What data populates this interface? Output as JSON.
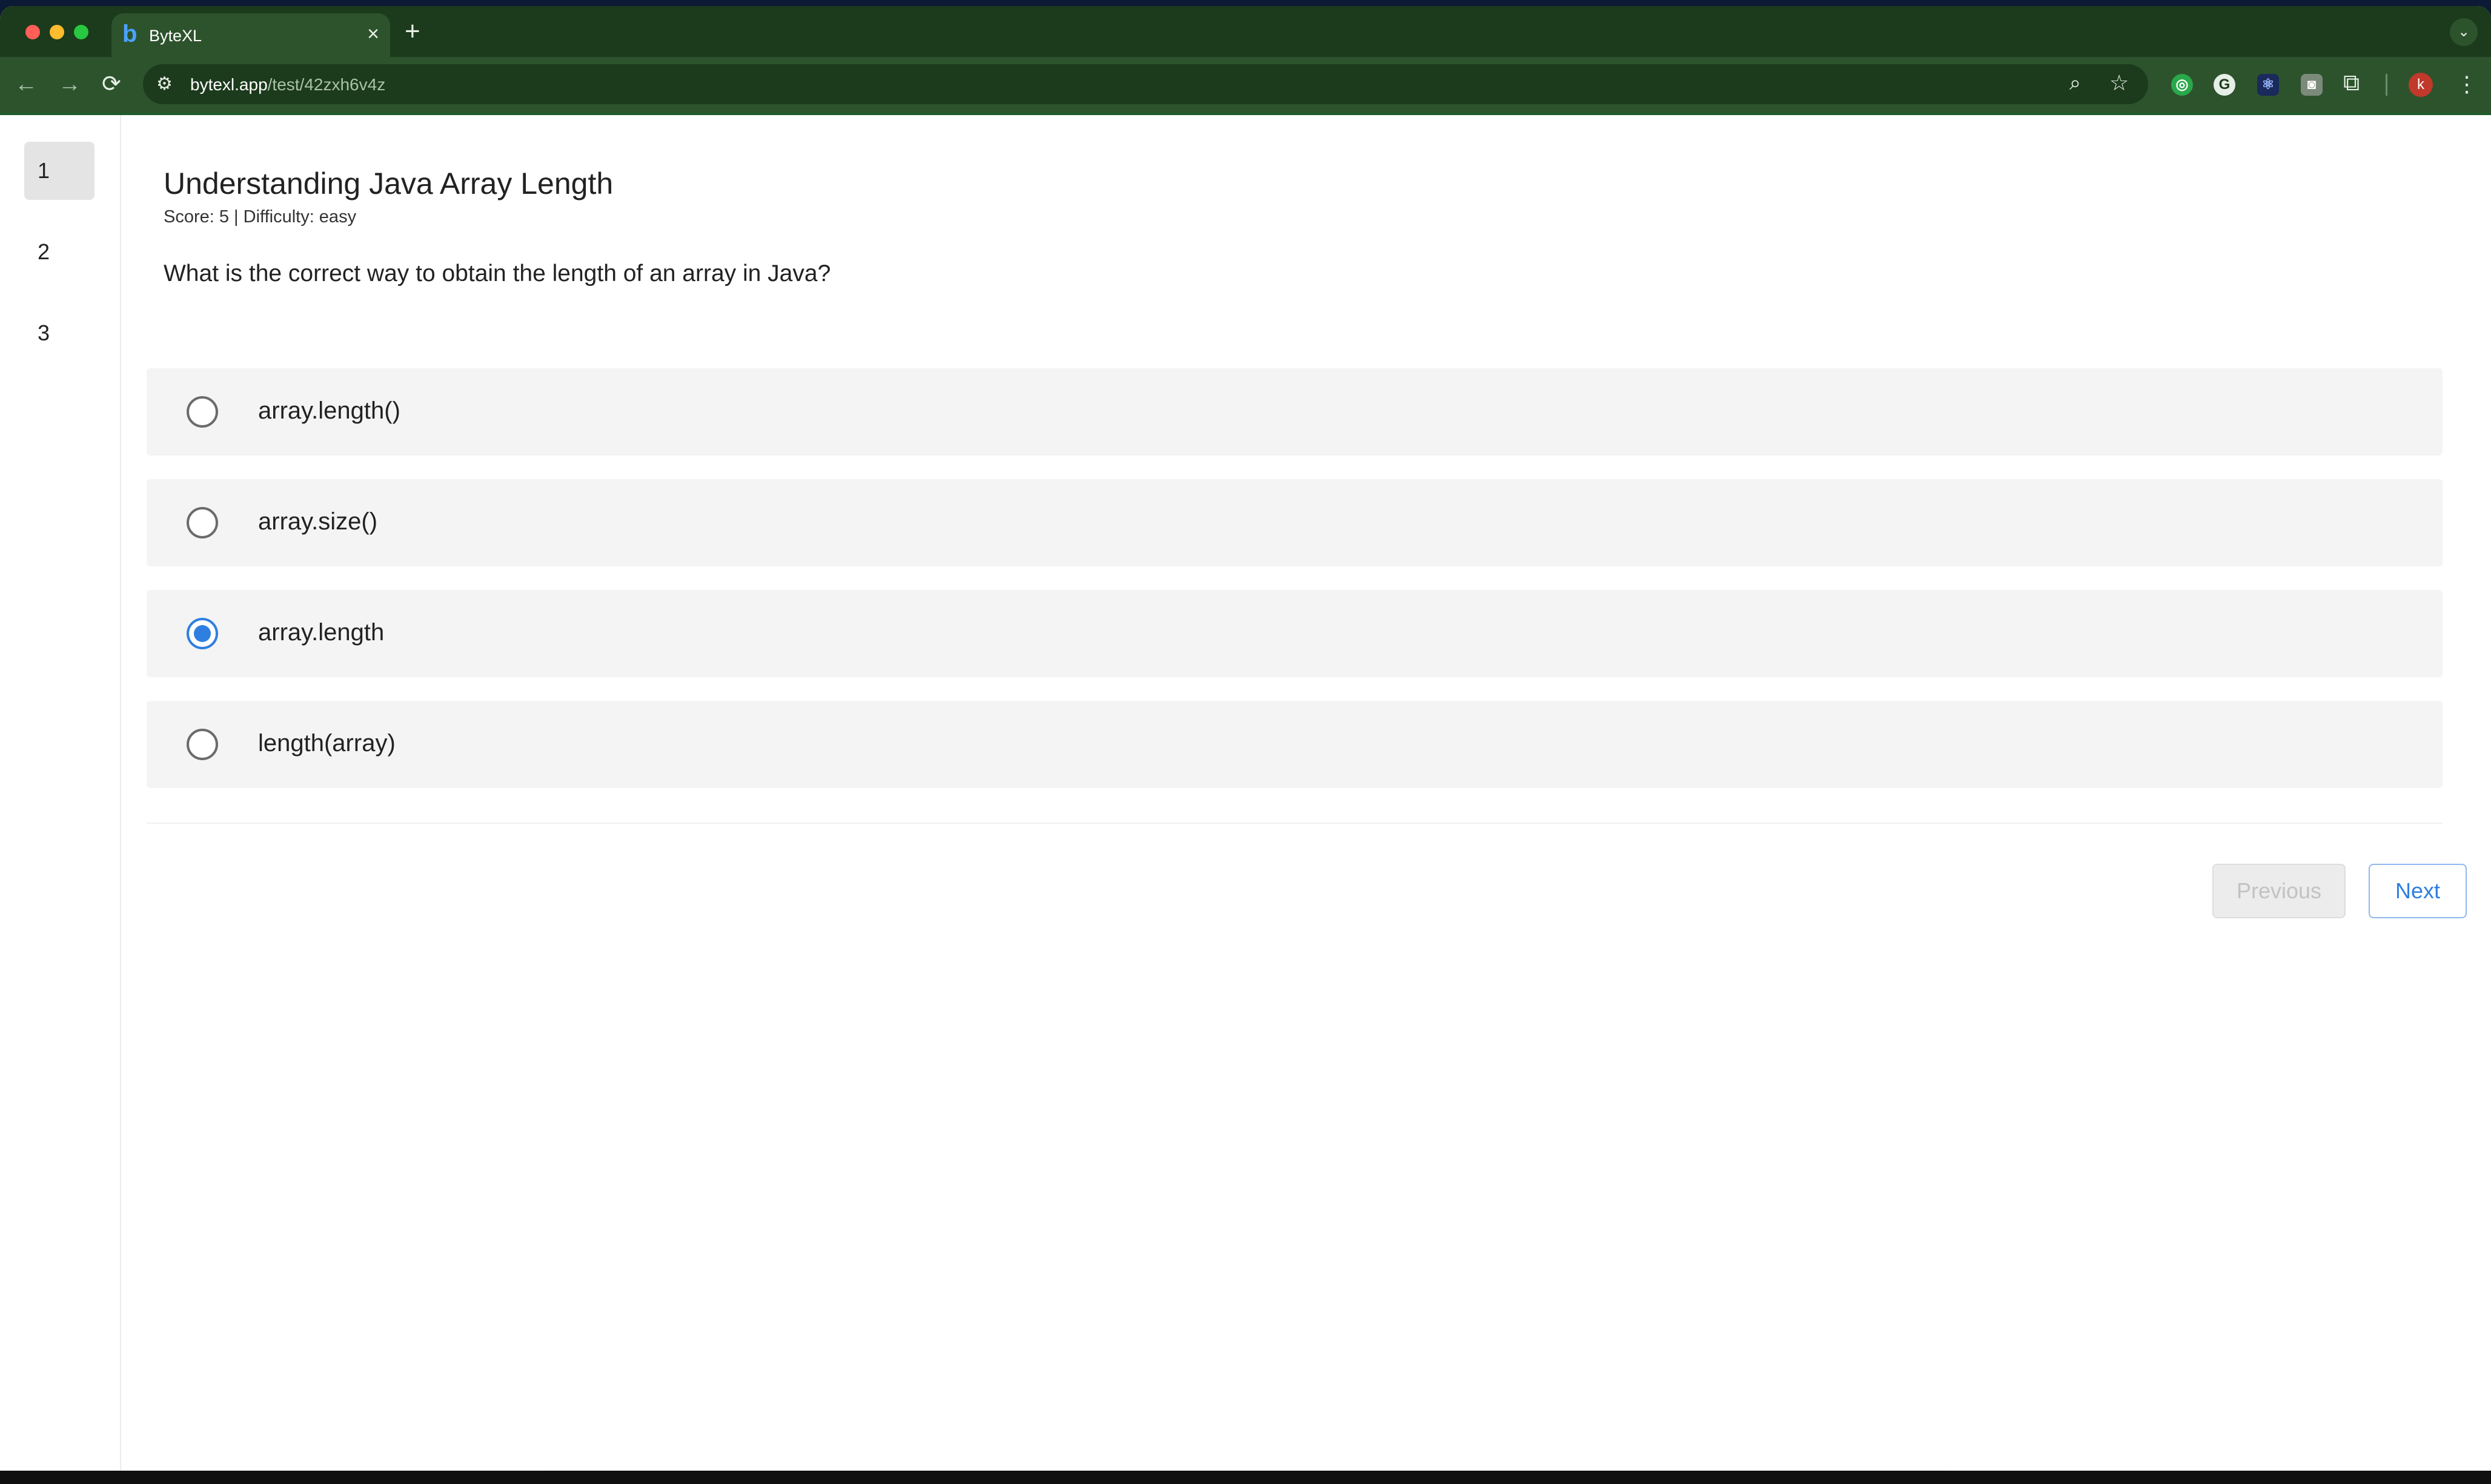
{
  "browser": {
    "tab": {
      "favicon": "b",
      "title": "ByteXL",
      "close_glyph": "×"
    },
    "new_tab_glyph": "+",
    "tab_menu_glyph": "⌄",
    "nav": {
      "back_glyph": "←",
      "forward_glyph": "→",
      "reload_glyph": "⟳"
    },
    "site_info_glyph": "⚙",
    "url": {
      "host": "bytexl.app",
      "path": "/test/42zxh6v4z"
    },
    "zoom_glyph": "⌕",
    "star_glyph": "☆",
    "extensions": [
      {
        "icon": "extension-green-icon",
        "glyph": "◎"
      },
      {
        "icon": "grammarly-icon",
        "glyph": "G"
      },
      {
        "icon": "react-devtools-icon",
        "glyph": "⚛"
      },
      {
        "icon": "camera-icon",
        "glyph": "◙"
      }
    ],
    "puzzle_glyph": "⧉",
    "avatar_letter": "k",
    "menu_glyph": "⋮",
    "accent_color": "#2d532d"
  },
  "sidebar": {
    "items": [
      {
        "label": "1",
        "active": true
      },
      {
        "label": "2",
        "active": false
      },
      {
        "label": "3",
        "active": false
      }
    ]
  },
  "question": {
    "title": "Understanding Java Array Length",
    "meta": "Score: 5 | Difficulty: easy",
    "text": "What is the correct way to obtain the length of an array in Java?",
    "options": [
      {
        "label": "array.length()",
        "selected": false
      },
      {
        "label": "array.size()",
        "selected": false
      },
      {
        "label": "array.length",
        "selected": true
      },
      {
        "label": "length(array)",
        "selected": false
      }
    ],
    "selected_color": "#2f7fe0"
  },
  "footer": {
    "previous_label": "Previous",
    "previous_disabled": true,
    "next_label": "Next"
  }
}
